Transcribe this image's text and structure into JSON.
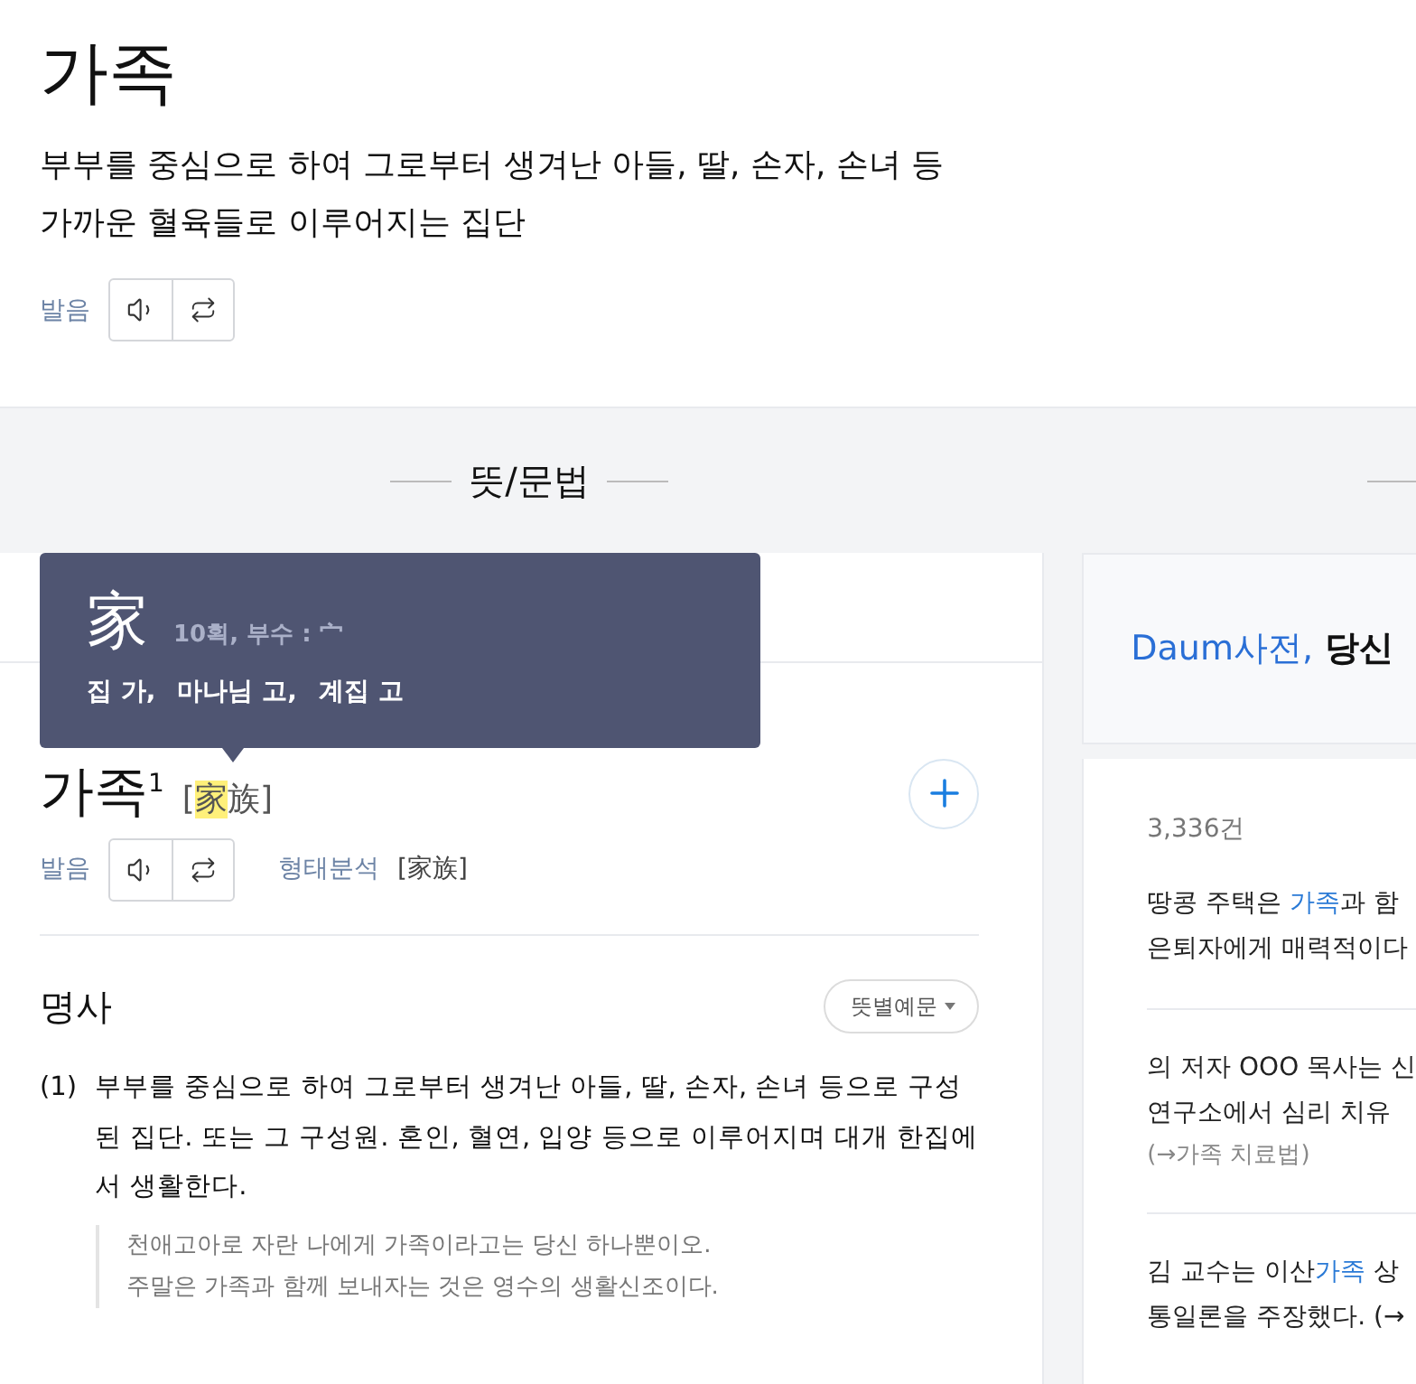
{
  "entry": {
    "word": "가족",
    "definition_lines": [
      "부부를 중심으로 하여 그로부터 생겨난 아들, 딸, 손자, 손녀 등",
      "가까운 혈육들로 이루어지는 집단"
    ],
    "pronunciation_label": "발음"
  },
  "section_title": "뜻/문법",
  "tooltip": {
    "character": "家",
    "info": "10획, 부수 : 宀",
    "meanings": [
      "집 가,",
      "마나님 고,",
      "계집 고"
    ]
  },
  "detail": {
    "headword": "가족$^{1}$",
    "hanja": [
      {
        "text": "[",
        "highlight": false
      },
      {
        "text": "家",
        "highlight": true
      },
      {
        "text": "族]",
        "highlight": false
      }
    ],
    "pronunciation_label": "발음",
    "morphology_label": "형태분석",
    "morphology_value": "[家族]",
    "part_of_speech": "명사",
    "examples_button": "뜻별예문",
    "senses": [
      {
        "number": "(1)",
        "text": "부부를 중심으로 하여 그로부터 생겨난 아들, 딸, 손자, 손녀 등으로 구성된 집단. 또는 그 구성원. 혼인, 혈연, 입양 등으로 이루어지며 대개 한집에서 생활한다.",
        "examples": [
          "천애고아로 자란 나에게 가족이라고는 당신 하나뿐이오.",
          "주말은 가족과 함께 보내자는 것은 영수의 생활신조이다."
        ]
      }
    ]
  },
  "banner": {
    "brand": "Daum사전,",
    "text": "당신"
  },
  "usage": {
    "count": "3,336건",
    "items": [
      {
        "lines": [
          [
            {
              "text": "땅콩 주택은 ",
              "highlight": false
            },
            {
              "text": "가족",
              "highlight": true
            },
            {
              "text": "과 함",
              "highlight": false
            }
          ],
          [
            {
              "text": "은퇴자에게 매력적이다",
              "highlight": false
            }
          ]
        ]
      },
      {
        "lines": [
          [
            {
              "text": "의 저자 OOO 목사는 신",
              "highlight": false
            }
          ],
          [
            {
              "text": "연구소에서 심리 치유",
              "highlight": false
            }
          ]
        ],
        "source": "(→가족 치료법)"
      },
      {
        "lines": [
          [
            {
              "text": "김 교수는 이산",
              "highlight": false
            },
            {
              "text": "가족",
              "highlight": true
            },
            {
              "text": " 상",
              "highlight": false
            }
          ],
          [
            {
              "text": "통일론을 주장했다.  (→",
              "highlight": false
            }
          ]
        ]
      }
    ]
  }
}
